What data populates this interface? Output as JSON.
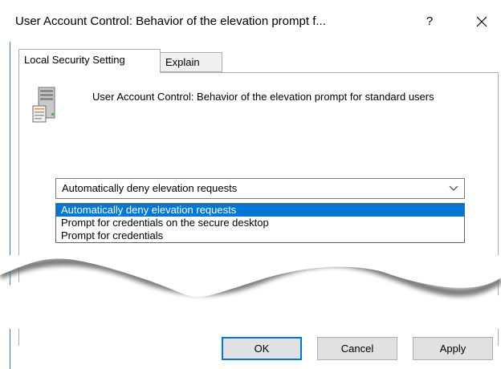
{
  "window": {
    "title": "User Account Control: Behavior of the elevation prompt f...",
    "help_label": "?"
  },
  "tabs": [
    {
      "label": "Local Security Setting"
    },
    {
      "label": "Explain"
    }
  ],
  "policy": {
    "description": "User Account Control: Behavior of the elevation prompt for standard users"
  },
  "setting": {
    "selected_value": "Automatically deny elevation requests",
    "options": [
      "Automatically deny elevation requests",
      "Prompt for credentials on the secure desktop",
      "Prompt for credentials"
    ]
  },
  "buttons": {
    "ok": "OK",
    "cancel": "Cancel",
    "apply": "Apply"
  },
  "colors": {
    "accent": "#0078d7",
    "border": "#adadad",
    "window_edge": "#3c7fb1"
  },
  "icons": {
    "policy": "server-computer-icon",
    "close": "close-icon",
    "dropdown": "chevron-down-icon"
  }
}
